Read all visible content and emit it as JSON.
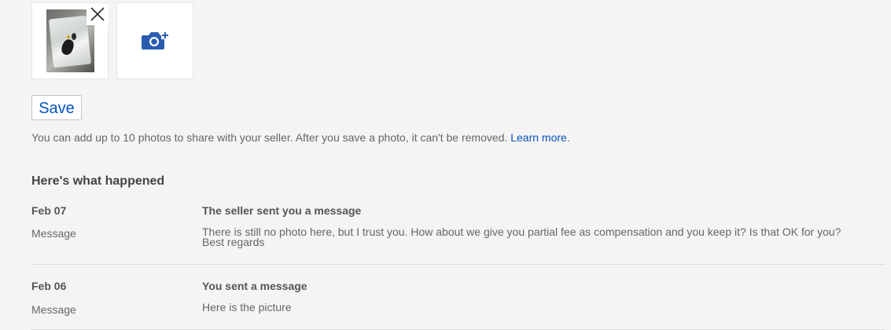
{
  "photos": {
    "thumbnail_alt": "uploaded photo",
    "remove_icon": "close-icon",
    "add_icon": "camera-plus-icon"
  },
  "save_label": "Save",
  "note": {
    "text": "You can add up to 10 photos to share with your seller. After you save a photo, it can't be removed. ",
    "link": "Learn more",
    "suffix": "."
  },
  "timeline": {
    "title": "Here's what happened",
    "events": [
      {
        "date": "Feb 07",
        "heading": "The seller sent you a message",
        "label": "Message",
        "body_line1": "There is still no photo here, but I trust you. How about we give you partial fee as compensation and you keep it? Is that OK for you?",
        "body_line2": "Best regards"
      },
      {
        "date": "Feb 06",
        "heading": "You sent a message",
        "label": "Message",
        "body_line1": "Here is the picture"
      }
    ]
  },
  "colors": {
    "background": "#f4f4f4",
    "link": "#0654ba",
    "camera_icon": "#2a5db0"
  }
}
